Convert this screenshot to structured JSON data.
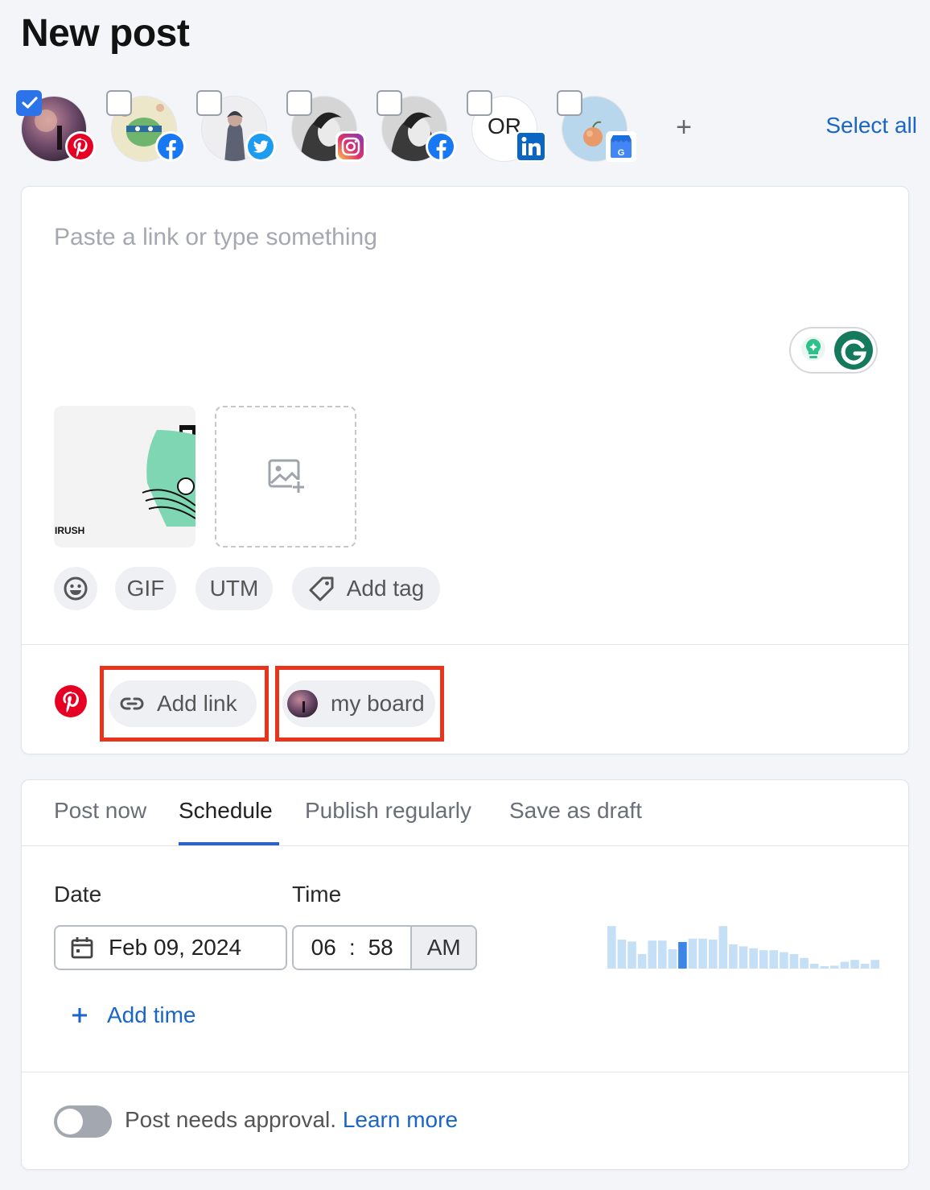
{
  "header": {
    "title": "New post"
  },
  "accounts": {
    "items": [
      {
        "network": "pinterest",
        "checked": true,
        "badge_text": ""
      },
      {
        "network": "facebook",
        "checked": false,
        "badge_text": ""
      },
      {
        "network": "twitter",
        "checked": false,
        "badge_text": ""
      },
      {
        "network": "instagram",
        "checked": false,
        "badge_text": ""
      },
      {
        "network": "facebook",
        "checked": false,
        "badge_text": ""
      },
      {
        "network": "linkedin",
        "checked": false,
        "badge_text": "OR"
      },
      {
        "network": "google-business",
        "checked": false,
        "badge_text": ""
      }
    ],
    "add_label": "+",
    "select_all_label": "Select all"
  },
  "composer": {
    "placeholder": "Paste a link or type something",
    "media_caption": "IRUSH",
    "tools": {
      "gif_label": "GIF",
      "utm_label": "UTM",
      "tag_label": "Add tag"
    },
    "pinterest": {
      "add_link_label": "Add link",
      "board_label": "my board"
    }
  },
  "schedule": {
    "tabs": [
      "Post now",
      "Schedule",
      "Publish regularly",
      "Save as draft"
    ],
    "active_tab": "Schedule",
    "date_label": "Date",
    "time_label": "Time",
    "date_value": "Feb 09, 2024",
    "time_hour": "06",
    "time_sep": ":",
    "time_minute": "58",
    "time_ampm": "AM",
    "add_time_label": "Add time",
    "activity_levels": [
      0.88,
      0.6,
      0.56,
      0.3,
      0.58,
      0.58,
      0.4,
      0.55,
      0.62,
      0.62,
      0.6,
      0.88,
      0.5,
      0.46,
      0.42,
      0.38,
      0.38,
      0.34,
      0.3,
      0.22,
      0.1,
      0.04,
      0.06,
      0.14,
      0.18,
      0.1,
      0.18
    ],
    "activity_highlight_index": 7,
    "approval_text": "Post needs approval.",
    "learn_more_label": "Learn more"
  },
  "colors": {
    "accent": "#2b73e8",
    "link": "#1a66c8",
    "highlight_box": "#e8341c",
    "pinterest": "#e60023",
    "bar": "#c5dff7",
    "bar_highlight": "#3b86e6"
  }
}
